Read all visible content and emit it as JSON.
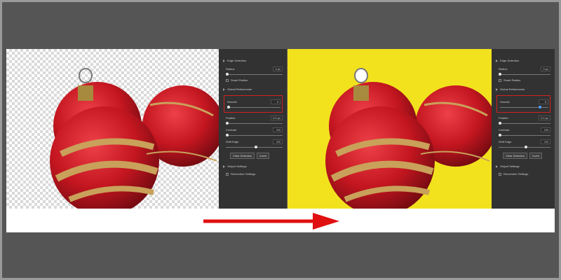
{
  "left_panel": {
    "edge_detection": "Edge Detection",
    "radius_label": "Radius",
    "radius_value": "0 px",
    "smart_radius": "Smart Radius",
    "global_refinements": "Global Refinements",
    "smooth_label": "Smooth",
    "smooth_value": "0",
    "feather_label": "Feather",
    "feather_value": "0.0 px",
    "contrast_label": "Contrast",
    "contrast_value": "0%",
    "shift_edge_label": "Shift Edge",
    "shift_edge_value": "0%",
    "clear_selection": "Clear Selection",
    "invert": "Invert",
    "output_settings": "Output Settings",
    "remember_settings": "Remember Settings"
  },
  "right_panel": {
    "edge_detection": "Edge Detection",
    "radius_label": "Radius",
    "radius_value": "0 px",
    "smart_radius": "Smart Radius",
    "global_refinements": "Global Refinements",
    "smooth_label": "Smooth",
    "smooth_value": "5",
    "feather_label": "Feather",
    "feather_value": "0.0 px",
    "contrast_label": "Contrast",
    "contrast_value": "0%",
    "shift_edge_label": "Shift Edge",
    "shift_edge_value": "0%",
    "clear_selection": "Clear Selection",
    "invert": "Invert",
    "output_settings": "Output Settings",
    "remember_settings": "Remember Settings"
  },
  "colors": {
    "background": "#555555",
    "panel": "#323232",
    "result_background": "#f2e21e",
    "highlight": "#d22020",
    "arrow": "#e01010",
    "ornament_red": "#c41620",
    "ornament_gold": "#c9a15a"
  },
  "icons": {
    "arrow": "right-arrow-icon",
    "ornament": "christmas-ornament-icon"
  }
}
